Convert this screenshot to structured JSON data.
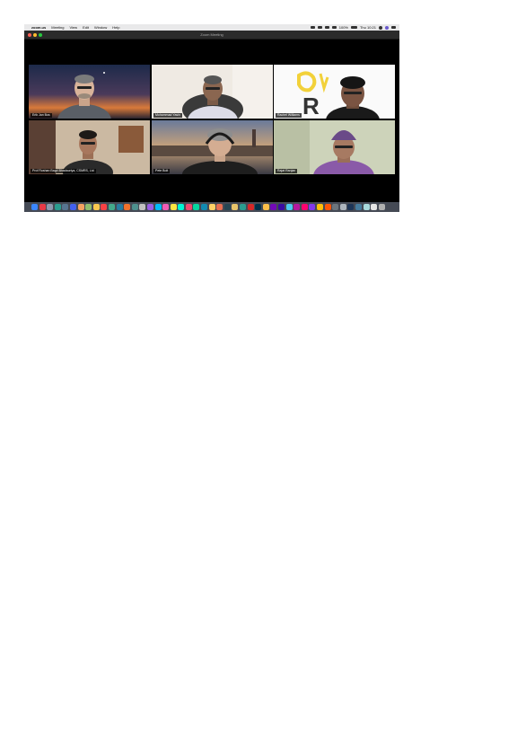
{
  "menubar": {
    "app": "zoom.us",
    "items": [
      "Meeting",
      "View",
      "Edit",
      "Window",
      "Help"
    ],
    "battery": "100%",
    "clock": "Thu 10:21"
  },
  "window": {
    "title": "Zoom Meeting"
  },
  "participants": [
    {
      "name": "Erik Jan Bos"
    },
    {
      "name": "Mohammad Yasin"
    },
    {
      "name": "Rachel Williams"
    },
    {
      "name": "Prof Roshan Bagri Bhadauriya, CSMRS, Ltd"
    },
    {
      "name": "Pete Bolt"
    },
    {
      "name": "Rajat Ranjan"
    }
  ],
  "dock": {
    "icon_colors": [
      "#3a86ff",
      "#e63946",
      "#8d99ae",
      "#2a9d8f",
      "#577590",
      "#4361ee",
      "#f4a261",
      "#90be6d",
      "#f9c74f",
      "#f94144",
      "#43aa8b",
      "#277da1",
      "#f3722c",
      "#4d908e",
      "#c0c0c0",
      "#9b5de5",
      "#00bbf9",
      "#f15bb5",
      "#fee440",
      "#00f5d4",
      "#ef476f",
      "#06d6a0",
      "#118ab2",
      "#ffd166",
      "#e76f51",
      "#264653",
      "#e9c46a",
      "#2a9d8f",
      "#d62828",
      "#003049",
      "#fcbf49",
      "#7209b7",
      "#3a0ca3",
      "#4cc9f0",
      "#b5179e",
      "#ff006e",
      "#8338ec",
      "#ffbe0b",
      "#fb5607",
      "#6c757d",
      "#adb5bd",
      "#1d3557",
      "#457b9d",
      "#a8dadc",
      "#e5e5e5",
      "#b0b0b0"
    ]
  }
}
